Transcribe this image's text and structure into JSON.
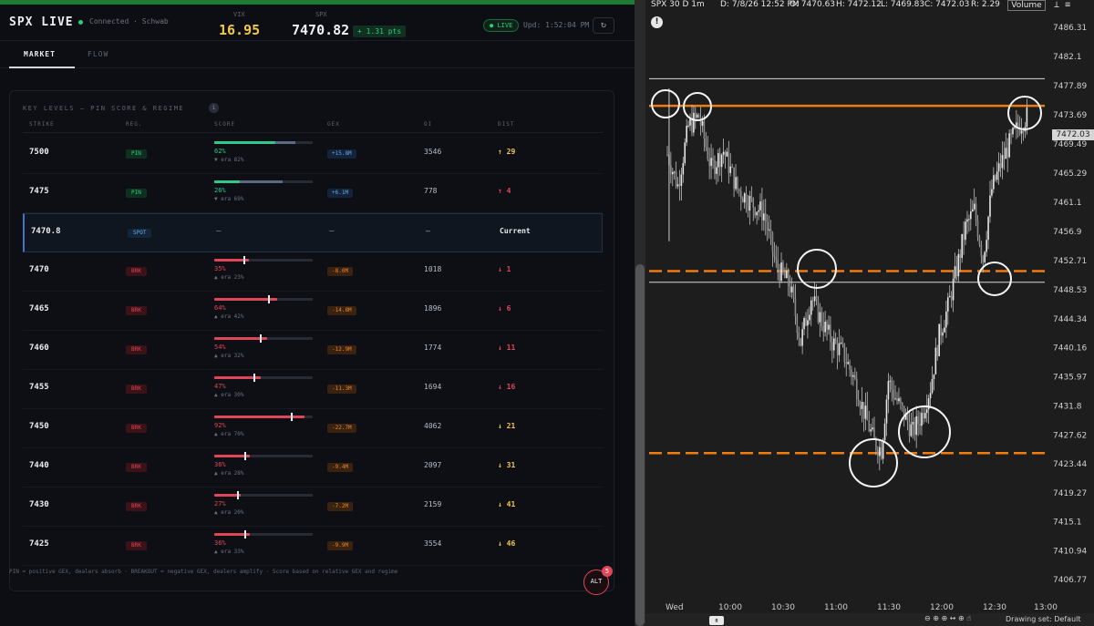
{
  "header": {
    "brand": "SPX LIVE",
    "connection": "Connected · Schwab",
    "vix_label": "VIX",
    "vix_value": "16.95",
    "spx_label": "SPX",
    "spx_value": "7470.82",
    "spx_change": "+ 1.31 pts",
    "live_label": "LIVE",
    "updated": "Upd: 1:52:04 PM",
    "refresh_icon": "↻"
  },
  "tabs": [
    {
      "label": "MARKET",
      "active": true
    },
    {
      "label": "FLOW",
      "active": false
    }
  ],
  "key_levels": {
    "title": "KEY LEVELS — PIN SCORE & REGIME",
    "info": "i",
    "columns": [
      "STRIKE",
      "REG.",
      "SCORE",
      "GEX",
      "OI",
      "DIST"
    ],
    "rows": [
      {
        "strike": "7500",
        "reg": "PIN",
        "score": "62%",
        "era": "▼ era 82%",
        "score_val": 0.62,
        "era_val": 0.82,
        "gex": "+15.8M",
        "oi": "3546",
        "dist": "↑ 29",
        "kind": "pin",
        "dist_kind": "green"
      },
      {
        "strike": "7475",
        "reg": "PIN",
        "score": "26%",
        "era": "▼ era 69%",
        "score_val": 0.26,
        "era_val": 0.69,
        "gex": "+6.1M",
        "oi": "778",
        "dist": "↑ 4",
        "kind": "pin",
        "dist_kind": "red"
      },
      {
        "strike": "7470.8",
        "reg": "SPOT",
        "score": "—",
        "gex": "—",
        "oi": "—",
        "dist": "Current",
        "kind": "spot",
        "dist_kind": "current"
      },
      {
        "strike": "7470",
        "reg": "BRK",
        "score": "35%",
        "era": "▲ era 23%",
        "score_val": 0.35,
        "era_val": 0.23,
        "gex": "-8.0M",
        "oi": "1018",
        "dist": "↓ 1",
        "kind": "brk",
        "dist_kind": "red"
      },
      {
        "strike": "7465",
        "reg": "BRK",
        "score": "64%",
        "era": "▲ era 42%",
        "score_val": 0.64,
        "era_val": 0.42,
        "gex": "-14.8M",
        "oi": "1896",
        "dist": "↓ 6",
        "kind": "brk",
        "dist_kind": "red"
      },
      {
        "strike": "7460",
        "reg": "BRK",
        "score": "54%",
        "era": "▲ era 32%",
        "score_val": 0.54,
        "era_val": 0.32,
        "gex": "-12.9M",
        "oi": "1774",
        "dist": "↓ 11",
        "kind": "brk",
        "dist_kind": "red"
      },
      {
        "strike": "7455",
        "reg": "BRK",
        "score": "47%",
        "era": "▲ era 30%",
        "score_val": 0.47,
        "era_val": 0.3,
        "gex": "-11.3M",
        "oi": "1694",
        "dist": "↓ 16",
        "kind": "brk",
        "dist_kind": "red"
      },
      {
        "strike": "7450",
        "reg": "BRK",
        "score": "92%",
        "era": "▲ era 70%",
        "score_val": 0.92,
        "era_val": 0.7,
        "gex": "-22.7M",
        "oi": "4062",
        "dist": "↓ 21",
        "kind": "brk",
        "dist_kind": "yellow"
      },
      {
        "strike": "7440",
        "reg": "BRK",
        "score": "36%",
        "era": "▲ era 28%",
        "score_val": 0.36,
        "era_val": 0.28,
        "gex": "-9.4M",
        "oi": "2097",
        "dist": "↓ 31",
        "kind": "brk",
        "dist_kind": "yellow"
      },
      {
        "strike": "7430",
        "reg": "BRK",
        "score": "27%",
        "era": "▲ era 20%",
        "score_val": 0.27,
        "era_val": 0.2,
        "gex": "-7.2M",
        "oi": "2159",
        "dist": "↓ 41",
        "kind": "brk",
        "dist_kind": "yellow"
      },
      {
        "strike": "7425",
        "reg": "BRK",
        "score": "36%",
        "era": "▲ era 33%",
        "score_val": 0.36,
        "era_val": 0.33,
        "gex": "-9.9M",
        "oi": "3554",
        "dist": "↓ 46",
        "kind": "brk",
        "dist_kind": "yellow"
      }
    ],
    "footnote": "PIN = positive GEX, dealers absorb · BREAKOUT = negative GEX, dealers amplify · Score based on relative GEX and regime"
  },
  "alert": {
    "label": "ALT",
    "count": "5"
  },
  "chart": {
    "symbol": "SPX 30 D 1m",
    "date": "D: 7/8/26 12:52 PM",
    "open": "O: 7470.63",
    "high": "H: 7472.12",
    "low": "L: 7469.83",
    "close": "C: 7472.03",
    "range": "R: 2.29",
    "volume_label": "Volume",
    "alert_icon": "!",
    "last_price": "7472.03",
    "footer": "Drawing set: Default",
    "y_ticks": [
      "7486.31",
      "7482.1",
      "7477.89",
      "7473.69",
      "7469.49",
      "7465.29",
      "7461.1",
      "7456.9",
      "7452.71",
      "7448.53",
      "7444.34",
      "7440.16",
      "7435.97",
      "7431.8",
      "7427.62",
      "7423.44",
      "7419.27",
      "7415.1",
      "7410.94",
      "7406.77"
    ],
    "x_ticks": [
      "Wed",
      "10:00",
      "10:30",
      "11:00",
      "11:30",
      "12:00",
      "12:30",
      "13:00"
    ],
    "accent": "#f07b12"
  },
  "chart_data": {
    "type": "candlestick",
    "ylim": [
      7404.7,
      7488.4
    ],
    "x": [
      "09:30",
      "13:00"
    ],
    "levels_solid_white": [
      7478.9,
      7449.6
    ],
    "levels_orange_solid": [
      7475.0
    ],
    "levels_orange_dashed": [
      7451.2,
      7425.0
    ],
    "close_path": [
      [
        0,
        7468.0
      ],
      [
        6,
        7463.5
      ],
      [
        12,
        7472.0
      ],
      [
        18,
        7473.5
      ],
      [
        25,
        7466.0
      ],
      [
        32,
        7468.5
      ],
      [
        40,
        7463.0
      ],
      [
        48,
        7461.0
      ],
      [
        55,
        7459.5
      ],
      [
        62,
        7452.0
      ],
      [
        70,
        7449.0
      ],
      [
        76,
        7441.0
      ],
      [
        82,
        7447.5
      ],
      [
        88,
        7444.0
      ],
      [
        94,
        7441.0
      ],
      [
        100,
        7439.5
      ],
      [
        106,
        7436.0
      ],
      [
        112,
        7431.0
      ],
      [
        118,
        7426.5
      ],
      [
        122,
        7425.5
      ],
      [
        126,
        7435.5
      ],
      [
        130,
        7433.0
      ],
      [
        135,
        7430.5
      ],
      [
        140,
        7428.0
      ],
      [
        145,
        7430.5
      ],
      [
        150,
        7434.5
      ],
      [
        155,
        7442.0
      ],
      [
        160,
        7446.0
      ],
      [
        165,
        7451.5
      ],
      [
        170,
        7457.5
      ],
      [
        175,
        7460.0
      ],
      [
        180,
        7453.0
      ],
      [
        185,
        7463.0
      ],
      [
        190,
        7466.5
      ],
      [
        195,
        7469.5
      ],
      [
        200,
        7472.0
      ],
      [
        205,
        7473.5
      ]
    ]
  }
}
